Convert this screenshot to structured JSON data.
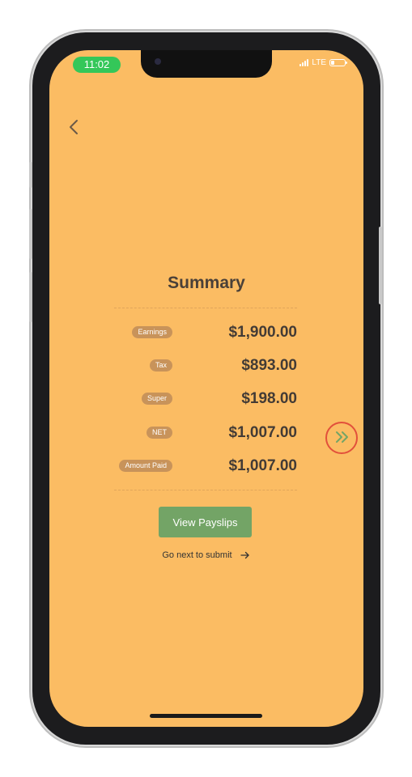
{
  "status_bar": {
    "time": "11:02",
    "network": "LTE"
  },
  "summary": {
    "title": "Summary",
    "rows": [
      {
        "label": "Earnings",
        "amount": "$1,900.00"
      },
      {
        "label": "Tax",
        "amount": "$893.00"
      },
      {
        "label": "Super",
        "amount": "$198.00"
      },
      {
        "label": "NET",
        "amount": "$1,007.00"
      },
      {
        "label": "Amount Paid",
        "amount": "$1,007.00"
      }
    ]
  },
  "actions": {
    "view_payslips": "View Payslips",
    "go_next": "Go next to submit"
  },
  "icons": {
    "back": "chevron-left-icon",
    "next": "double-chevron-right-icon",
    "arrow": "arrow-right-icon"
  },
  "colors": {
    "background": "#fbbc63",
    "button": "#73a466",
    "tag": "#c8935a",
    "highlight": "#e2503b",
    "time_pill": "#34c759"
  }
}
